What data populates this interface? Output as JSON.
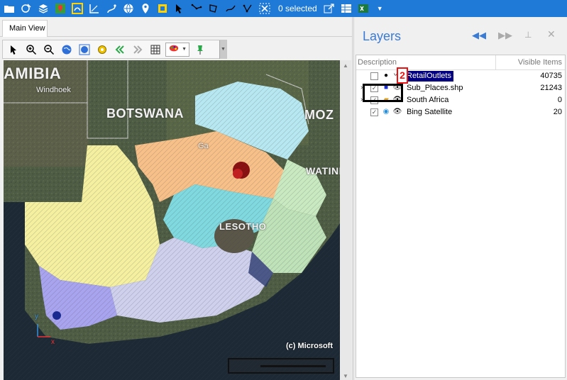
{
  "toolbar": {
    "selected_count": "0 selected",
    "icons": [
      "folder-icon",
      "geo-edit-icon",
      "layers-stack-icon",
      "map-pin-icon",
      "select-box-icon",
      "measure-icon",
      "path-icon",
      "globe-icon",
      "location-pin-icon",
      "frame-icon",
      "select-arrow-icon",
      "line-select-icon",
      "polygon-select-icon",
      "freehand-select-icon",
      "poly-node-icon",
      "clear-selection-icon",
      "export-icon",
      "table-icon",
      "excel-icon"
    ]
  },
  "main_view": {
    "tab_label": "Main View",
    "map_tools": [
      "pointer-icon",
      "zoom-in-icon",
      "zoom-out-icon",
      "globe-full-icon",
      "globe-extent-icon",
      "gear-icon",
      "back-icon",
      "forward-icon",
      "grid-icon",
      "palette-icon",
      "pin-icon"
    ],
    "map_labels": {
      "namibia": "AMIBIA",
      "botswana": "BOTSWANA",
      "mozambique": "MOZ",
      "swatini": "WATINI",
      "lesotho": "LESOTHO",
      "windhoek": "Windhoek",
      "gaborone": "Ga"
    },
    "copyright": "(c) Microsoft",
    "axis_x": "x",
    "axis_y": "y"
  },
  "layers_panel": {
    "title": "Layers",
    "columns": {
      "description": "Description",
      "visible_items": "Visible Items"
    },
    "annotation_badge": "2",
    "rows": [
      {
        "name": "RetailOutlets",
        "count": "40735",
        "checked": false,
        "selected": true
      },
      {
        "name": "Sub_Places.shp",
        "count": "21243",
        "checked": true,
        "selected": false
      },
      {
        "name": "South Africa",
        "count": "0",
        "checked": true,
        "selected": false
      },
      {
        "name": "Bing Satellite",
        "count": "20",
        "checked": true,
        "selected": false
      }
    ]
  },
  "colors": {
    "toolbar_bg": "#1e7ad6",
    "accent": "#3a7bd5",
    "selection": "#000080"
  }
}
